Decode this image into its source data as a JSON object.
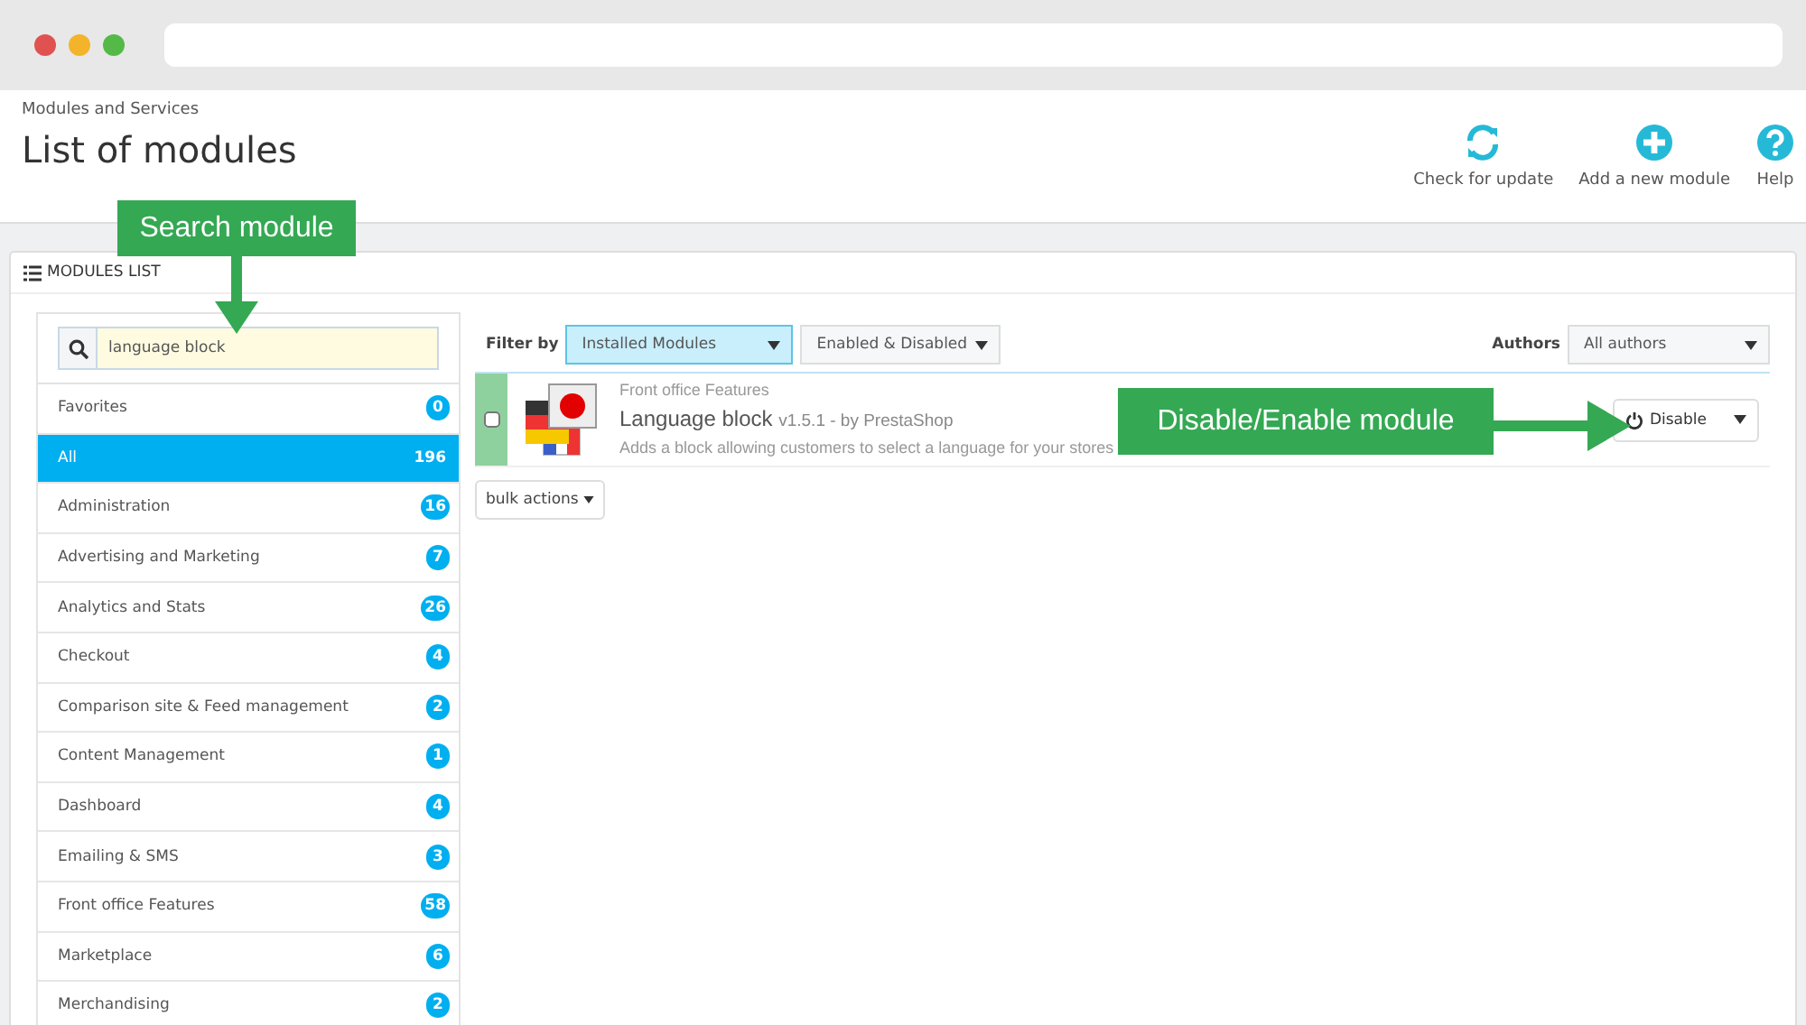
{
  "breadcrumb": "Modules and Services",
  "title": "List of modules",
  "toolbar": [
    {
      "kind": "refresh",
      "label": "Check for update"
    },
    {
      "kind": "add",
      "label": "Add a new module"
    },
    {
      "kind": "help",
      "label": "Help"
    }
  ],
  "panel_title": "MODULES LIST",
  "search": {
    "value": "language block"
  },
  "categories": [
    {
      "name": "Favorites",
      "count": "0",
      "selected": false
    },
    {
      "name": "All",
      "count": "196",
      "selected": true
    },
    {
      "name": "Administration",
      "count": "16",
      "selected": false
    },
    {
      "name": "Advertising and Marketing",
      "count": "7",
      "selected": false
    },
    {
      "name": "Analytics and Stats",
      "count": "26",
      "selected": false
    },
    {
      "name": "Checkout",
      "count": "4",
      "selected": false
    },
    {
      "name": "Comparison site & Feed management",
      "count": "2",
      "selected": false
    },
    {
      "name": "Content Management",
      "count": "1",
      "selected": false
    },
    {
      "name": "Dashboard",
      "count": "4",
      "selected": false
    },
    {
      "name": "Emailing & SMS",
      "count": "3",
      "selected": false
    },
    {
      "name": "Front office Features",
      "count": "58",
      "selected": false
    },
    {
      "name": "Marketplace",
      "count": "6",
      "selected": false
    },
    {
      "name": "Merchandising",
      "count": "2",
      "selected": false
    }
  ],
  "filter": {
    "label": "Filter by",
    "selects": [
      {
        "value": "Installed Modules",
        "focused": true
      },
      {
        "value": "Enabled & Disabled",
        "focused": false
      }
    ],
    "authors_label": "Authors",
    "authors_value": "All authors"
  },
  "module": {
    "category": "Front office Features",
    "name": "Language block",
    "version": "v1.5.1 - by PrestaShop",
    "description": "Adds a block allowing customers to select a language for your stores",
    "checked": false,
    "action": "Disable"
  },
  "bulk_actions": "bulk actions",
  "callouts": [
    {
      "kind": "down",
      "text": "Search module"
    },
    {
      "kind": "right",
      "text": "Disable/Enable module"
    }
  ]
}
